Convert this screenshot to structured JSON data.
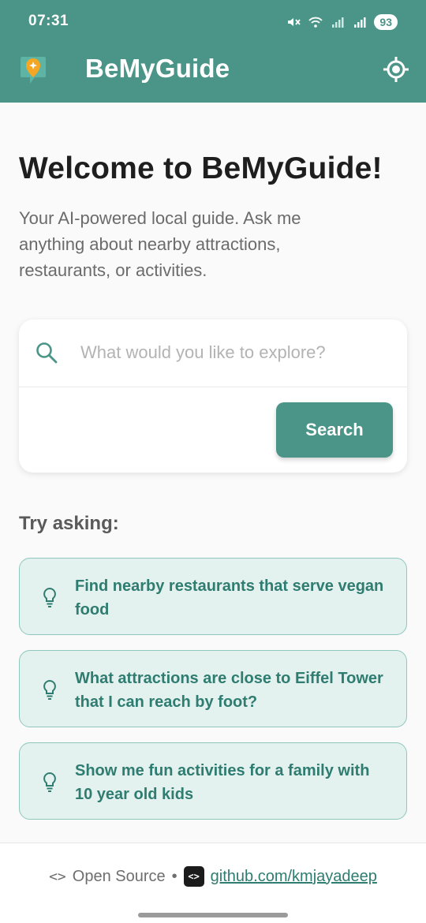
{
  "status": {
    "time": "07:31",
    "battery": "93",
    "icons": [
      "mute-icon",
      "wifi-icon",
      "signal-icon",
      "signal-icon"
    ]
  },
  "appbar": {
    "title": "BeMyGuide",
    "logo_icon": "map-pin-star-icon",
    "action_icon": "my-location-icon"
  },
  "hero": {
    "welcome": "Welcome to BeMyGuide!",
    "subtitle": "Your AI-powered local guide. Ask me anything about nearby attractions, restaurants, or activities."
  },
  "search": {
    "placeholder": "What would you like to explore?",
    "button_label": "Search"
  },
  "suggestions": {
    "title": "Try asking:",
    "items": [
      {
        "text": "Find nearby restaurants that serve vegan food"
      },
      {
        "text": "What attractions are close to Eiffel Tower that I can reach by foot?"
      },
      {
        "text": "Show me fun activities for a family with 10 year old kids"
      }
    ]
  },
  "footer": {
    "code_glyph": "<>",
    "open_source": "Open Source",
    "separator": "•",
    "github_glyph": "<>",
    "github_link": "github.com/kmjayadeep"
  },
  "colors": {
    "primary": "#4a9587",
    "suggestion_bg": "#e3f1ef",
    "suggestion_border": "#8fc7bd",
    "suggestion_text": "#2f7c70",
    "logo_orange": "#f5a623"
  }
}
